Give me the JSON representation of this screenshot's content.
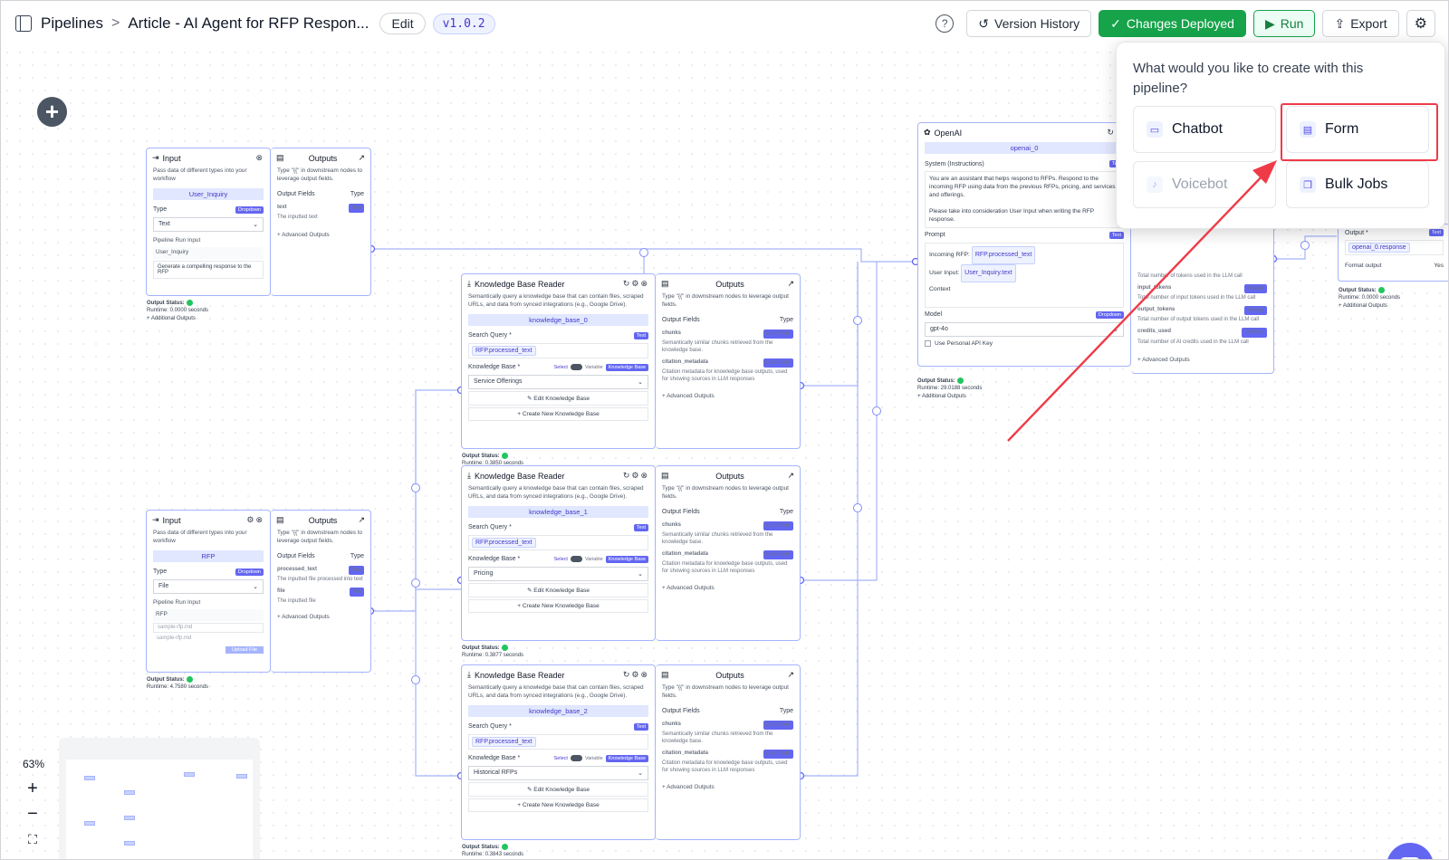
{
  "header": {
    "crumb_root": "Pipelines",
    "crumb_sep": ">",
    "crumb_page": "Article - AI Agent for RFP Respon...",
    "edit_label": "Edit",
    "version": "v1.0.2",
    "help": "?",
    "version_history": "Version History",
    "changes_deployed": "Changes Deployed",
    "run": "Run",
    "export": "Export",
    "settings_icon": "gear-icon"
  },
  "popup": {
    "question": "What would you like to create with this pipeline?",
    "options": [
      {
        "label": "Chatbot",
        "icon": "chat-icon"
      },
      {
        "label": "Form",
        "icon": "form-icon"
      },
      {
        "label": "Voicebot",
        "icon": "microphone-icon",
        "disabled": true
      },
      {
        "label": "Bulk Jobs",
        "icon": "stack-icon"
      }
    ]
  },
  "zoom": {
    "level": "63%"
  },
  "accent": "#6366f1",
  "nodes": {
    "input1": {
      "title": "Input",
      "desc": "Pass data of different types into your workflow",
      "name": "User_Inquiry",
      "type_label": "Type",
      "type_badge": "Dropdown",
      "type_value": "Text",
      "run_label": "Pipeline Run Input",
      "run_name": "User_Inquiry",
      "run_value": "Generate a compelling response to the RFP",
      "outputs_title": "Outputs",
      "outputs_desc": "Type \"{{\" in downstream nodes to leverage output fields.",
      "of_label": "Output Fields",
      "type_col": "Type",
      "field_name": "text",
      "field_badge": "Text",
      "field_desc": "The inputted text",
      "adv": "+ Advanced Outputs",
      "status": "Output Status:",
      "runtime": "Runtime: 0.0000 seconds",
      "additional": "+ Additional Outputs"
    },
    "input2": {
      "title": "Input",
      "desc": "Pass data of different types into your workflow",
      "name": "RFP",
      "type_label": "Type",
      "type_badge": "Dropdown",
      "type_value": "File",
      "run_label": "Pipeline Run Input",
      "run_name": "RFP",
      "file1": "sample-rfp.md",
      "file2": "sample-rfp.md",
      "upload": "Upload File",
      "outputs_title": "Outputs",
      "outputs_desc": "Type \"{{\" in downstream nodes to leverage output fields.",
      "of_label": "Output Fields",
      "type_col": "Type",
      "f1_name": "processed_text",
      "f1_badge": "Text",
      "f1_desc": "The inputted file processed into text",
      "f2_name": "file",
      "f2_badge": "File",
      "f2_desc": "The inputted file",
      "adv": "+ Advanced Outputs",
      "status": "Output Status:",
      "runtime": "Runtime: 4.7580 seconds"
    },
    "kb": [
      {
        "title": "Knowledge Base Reader",
        "desc": "Semantically query a knowledge base that can contain files, scraped URLs, and data from synced integrations (e.g., Google Drive).",
        "name": "knowledge_base_0",
        "sq": "Search Query *",
        "sq_badge": "Text",
        "chip": "RFP.processed_text",
        "kb_label": "Knowledge Base *",
        "select": "Select",
        "variable": "Variable",
        "kb_badge": "Knowledge Base",
        "kb_value": "Service Offerings",
        "edit": "Edit Knowledge Base",
        "create": "+ Create New Knowledge Base",
        "status": "Output Status:",
        "runtime": "Runtime: 0.3850 seconds"
      },
      {
        "title": "Knowledge Base Reader",
        "desc": "Semantically query a knowledge base that can contain files, scraped URLs, and data from synced integrations (e.g., Google Drive).",
        "name": "knowledge_base_1",
        "sq": "Search Query *",
        "sq_badge": "Text",
        "chip": "RFP.processed_text",
        "kb_label": "Knowledge Base *",
        "select": "Select",
        "variable": "Variable",
        "kb_badge": "Knowledge Base",
        "kb_value": "Pricing",
        "edit": "Edit Knowledge Base",
        "create": "+ Create New Knowledge Base",
        "status": "Output Status:",
        "runtime": "Runtime: 0.3877 seconds"
      },
      {
        "title": "Knowledge Base Reader",
        "desc": "Semantically query a knowledge base that can contain files, scraped URLs, and data from synced integrations (e.g., Google Drive).",
        "name": "knowledge_base_2",
        "sq": "Search Query *",
        "sq_badge": "Text",
        "chip": "RFP.processed_text",
        "kb_label": "Knowledge Base *",
        "select": "Select",
        "variable": "Variable",
        "kb_badge": "Knowledge Base",
        "kb_value": "Historical RFPs",
        "edit": "Edit Knowledge Base",
        "create": "+ Create New Knowledge Base",
        "status": "Output Status:",
        "runtime": "Runtime: 0.3843 seconds"
      }
    ],
    "kb_out": {
      "title": "Outputs",
      "desc": "Type \"{{\" in downstream nodes to leverage output fields.",
      "of_label": "Output Fields",
      "type_col": "Type",
      "chunks": "chunks",
      "chunks_badge": "List<Text>",
      "chunks_desc": "Semantically similar chunks retrieved from the knowledge base.",
      "cit": "citation_metadata",
      "cit_badge": "List<Text>",
      "cit_desc": "Citation metadata for knowledge base outputs, used for showing sources in LLM responses",
      "adv": "+ Advanced Outputs"
    },
    "openai": {
      "title": "OpenAI",
      "name": "openai_0",
      "sys_label": "System (Instructions)",
      "sys_badge": "Text",
      "sys_text": "You are an assistant that helps respond to RFPs. Respond to the incoming RFP using data from the previous RFPs, pricing, and services and offerings.",
      "sys_text2": "Please take into consideration User Input when writing the RFP response.",
      "prompt_label": "Prompt",
      "prompt_badge": "Text",
      "p1": "Incoming RFP:",
      "p1_chip": "RFP.processed_text",
      "p2": "User Input:",
      "p2_chip": "User_Inquiry.text",
      "p3": "Context",
      "model_label": "Model",
      "model_badge": "Dropdown",
      "model_value": "gpt-4o",
      "api": "Use Personal API Key",
      "status": "Output Status:",
      "runtime": "Runtime: 29.0188 seconds",
      "additional": "+ Additional Outputs",
      "o0_desc": "Total number of tokens used in the LLM call",
      "o1": "input_tokens",
      "o1_badge": "Integer",
      "o1_desc": "Total number of input tokens used in the LLM call",
      "o2": "output_tokens",
      "o2_badge": "Integer",
      "o2_desc": "Total number of output tokens used in the LLM call",
      "o3": "credits_used",
      "o3_badge": "Decimal",
      "o3_desc": "Total number of AI credits used in the LLM call",
      "adv": "+ Advanced Outputs"
    },
    "output": {
      "label": "Output *",
      "badge": "Text",
      "chip": "openai_0.response",
      "format": "Format output",
      "yes": "Yes",
      "status": "Output Status:",
      "runtime": "Runtime: 0.0000 seconds",
      "additional": "+ Additional Outputs"
    }
  }
}
